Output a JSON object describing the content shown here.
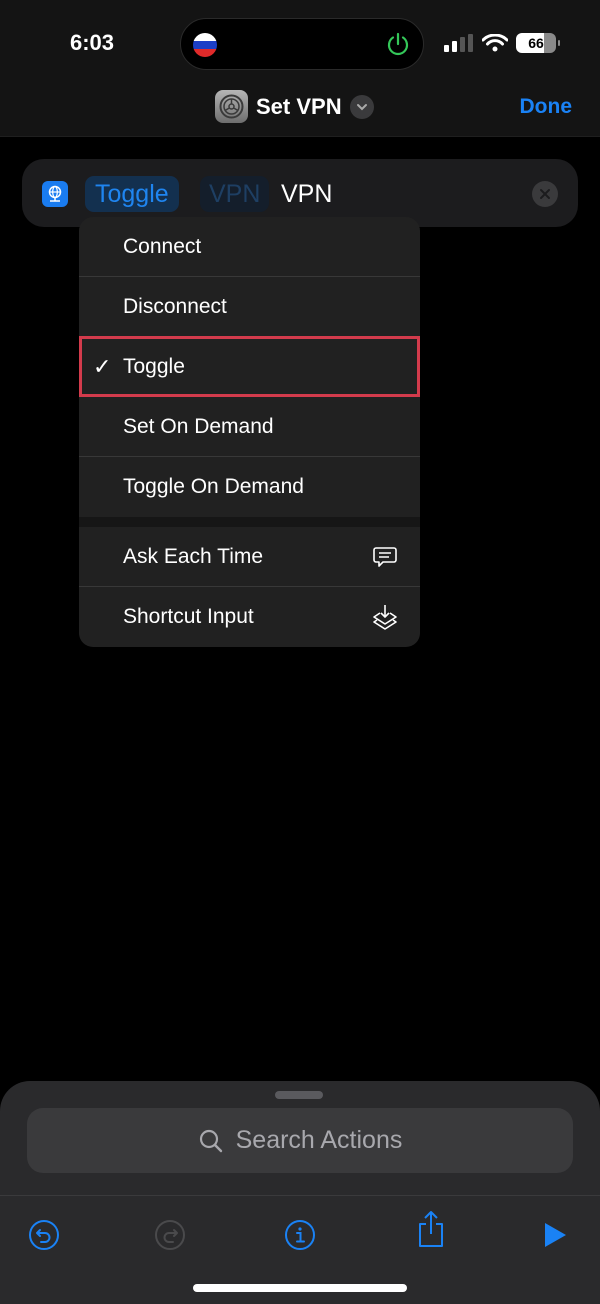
{
  "status_bar": {
    "time": "6:03",
    "battery": "66",
    "island_left_icon": "russia-flag-icon",
    "island_right_icon": "power-icon",
    "colors": {
      "power": "#34c759"
    }
  },
  "nav": {
    "app_icon": "settings-gear-icon",
    "title": "Set VPN",
    "title_menu_icon": "chevron-down-icon",
    "done_label": "Done"
  },
  "action": {
    "icon": "vpn-globe-icon",
    "operation_value": "Toggle",
    "target_placeholder": "VPN",
    "target_value": "VPN",
    "clear_icon": "close-icon"
  },
  "menu": {
    "items": [
      {
        "label": "Connect",
        "selected": false
      },
      {
        "label": "Disconnect",
        "selected": false
      },
      {
        "label": "Toggle",
        "selected": true
      },
      {
        "label": "Set On Demand",
        "selected": false
      },
      {
        "label": "Toggle On Demand",
        "selected": false
      }
    ],
    "variables": [
      {
        "label": "Ask Each Time",
        "icon": "speech-bubble-icon"
      },
      {
        "label": "Shortcut Input",
        "icon": "shortcut-input-icon"
      }
    ],
    "check_glyph": "✓"
  },
  "bottom": {
    "search_placeholder": "Search Actions",
    "toolbar": [
      "undo",
      "redo",
      "info",
      "share",
      "run"
    ]
  },
  "colors": {
    "accent": "#1a82f5",
    "highlight_border": "#d33b4c"
  }
}
